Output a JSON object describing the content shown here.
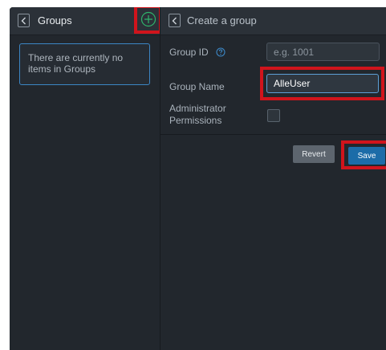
{
  "left_panel": {
    "title": "Groups",
    "empty_message": "There are currently no items in Groups"
  },
  "right_panel": {
    "title": "Create a group",
    "group_id": {
      "label": "Group ID",
      "value": "",
      "placeholder": "e.g. 1001"
    },
    "group_name": {
      "label": "Group Name",
      "value": "AlleUser"
    },
    "admin_permissions": {
      "label": "Administrator Permissions",
      "checked": false
    },
    "revert_label": "Revert",
    "save_label": "Save"
  },
  "icons": {
    "back": "chevron-left-icon",
    "add": "plus-circle-icon",
    "help": "question-circle-icon"
  },
  "colors": {
    "background": "#22272d",
    "header": "#2b3138",
    "accent": "#3c86c4",
    "save": "#1c6ca8",
    "add_icon": "#2fb36b",
    "highlight": "#d0141c"
  }
}
